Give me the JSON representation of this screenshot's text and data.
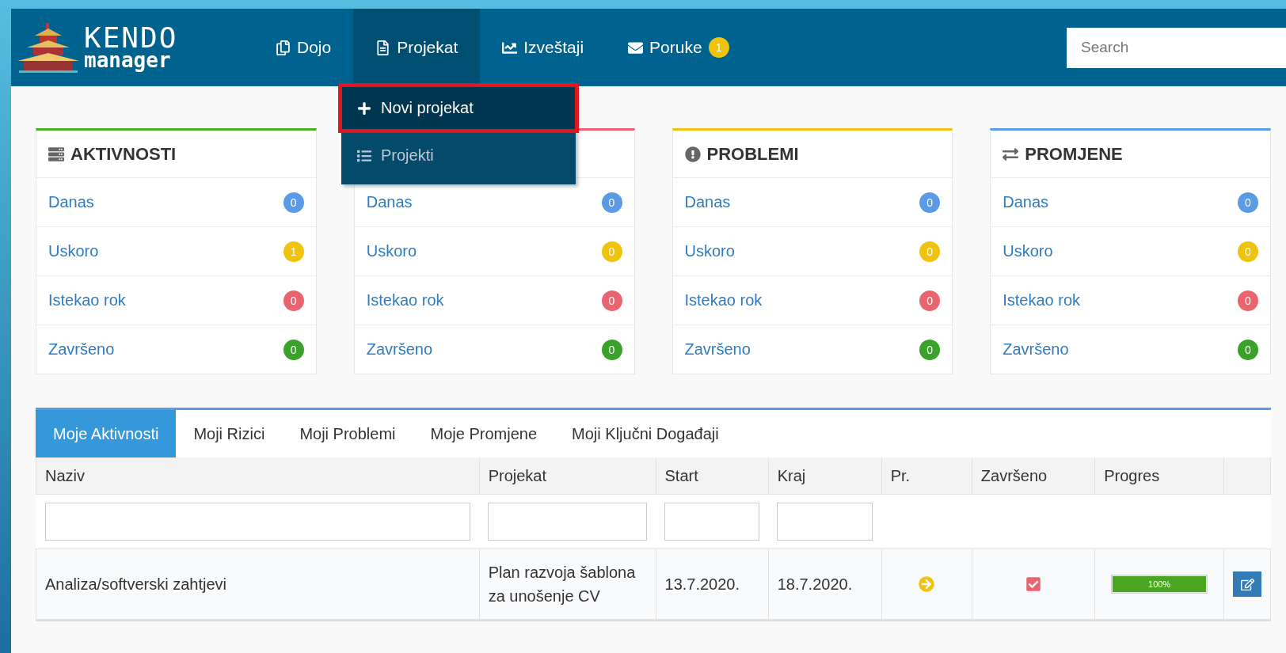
{
  "logo": {
    "title": "KENDO",
    "subtitle": "manager"
  },
  "nav": [
    {
      "label": "Dojo",
      "selected": false
    },
    {
      "label": "Projekat",
      "selected": true
    },
    {
      "label": "Izveštaji",
      "selected": false
    },
    {
      "label": "Poruke",
      "selected": false,
      "badge": "1"
    }
  ],
  "search": {
    "placeholder": "Search"
  },
  "dropdown": [
    {
      "label": "Novi projekat",
      "selected": true
    },
    {
      "label": "Projekti",
      "selected": false
    }
  ],
  "cards": [
    {
      "title": "AKTIVNOSTI",
      "color": "#4caf1f",
      "rows": [
        {
          "label": "Danas",
          "count": "0",
          "color": "#5b9be6"
        },
        {
          "label": "Uskoro",
          "count": "1",
          "color": "#f0c30f"
        },
        {
          "label": "Istekao rok",
          "count": "0",
          "color": "#e8646e"
        },
        {
          "label": "Završeno",
          "count": "0",
          "color": "#3aa12a"
        }
      ]
    },
    {
      "color": "#e8646e",
      "rows": [
        {
          "label": "Danas",
          "count": "0",
          "color": "#5b9be6"
        },
        {
          "label": "Uskoro",
          "count": "0",
          "color": "#f0c30f"
        },
        {
          "label": "Istekao rok",
          "count": "0",
          "color": "#e8646e"
        },
        {
          "label": "Završeno",
          "count": "0",
          "color": "#3aa12a"
        }
      ]
    },
    {
      "title": "PROBLEMI",
      "color": "#f0c30f",
      "rows": [
        {
          "label": "Danas",
          "count": "0",
          "color": "#5b9be6"
        },
        {
          "label": "Uskoro",
          "count": "0",
          "color": "#f0c30f"
        },
        {
          "label": "Istekao rok",
          "count": "0",
          "color": "#e8646e"
        },
        {
          "label": "Završeno",
          "count": "0",
          "color": "#3aa12a"
        }
      ]
    },
    {
      "title": "PROMJENE",
      "color": "#5b9be6",
      "rows": [
        {
          "label": "Danas",
          "count": "0",
          "color": "#5b9be6"
        },
        {
          "label": "Uskoro",
          "count": "0",
          "color": "#f0c30f"
        },
        {
          "label": "Istekao rok",
          "count": "0",
          "color": "#e8646e"
        },
        {
          "label": "Završeno",
          "count": "0",
          "color": "#3aa12a"
        }
      ]
    }
  ],
  "tabs": [
    {
      "label": "Moje Aktivnosti",
      "selected": true
    },
    {
      "label": "Moji Rizici",
      "selected": false
    },
    {
      "label": "Moji Problemi",
      "selected": false
    },
    {
      "label": "Moje Promjene",
      "selected": false
    },
    {
      "label": "Moji Ključni Događaji",
      "selected": false
    }
  ],
  "table": {
    "columns": [
      {
        "label": "Naziv",
        "filter": true
      },
      {
        "label": "Projekat",
        "filter": true
      },
      {
        "label": "Start",
        "filter": true
      },
      {
        "label": "Kraj",
        "filter": true
      },
      {
        "label": "Pr.",
        "filter": false
      },
      {
        "label": "Završeno",
        "filter": false
      },
      {
        "label": "Progres",
        "filter": false
      },
      {
        "filter": false
      }
    ],
    "rows": [
      {
        "naziv": "Analiza/softverski zahtjevi",
        "projekat": "Plan razvoja šablona za unošenje CV",
        "start": "13.7.2020.",
        "kraj": "18.7.2020.",
        "done": true,
        "level": 1,
        "progress": "100%"
      }
    ]
  }
}
